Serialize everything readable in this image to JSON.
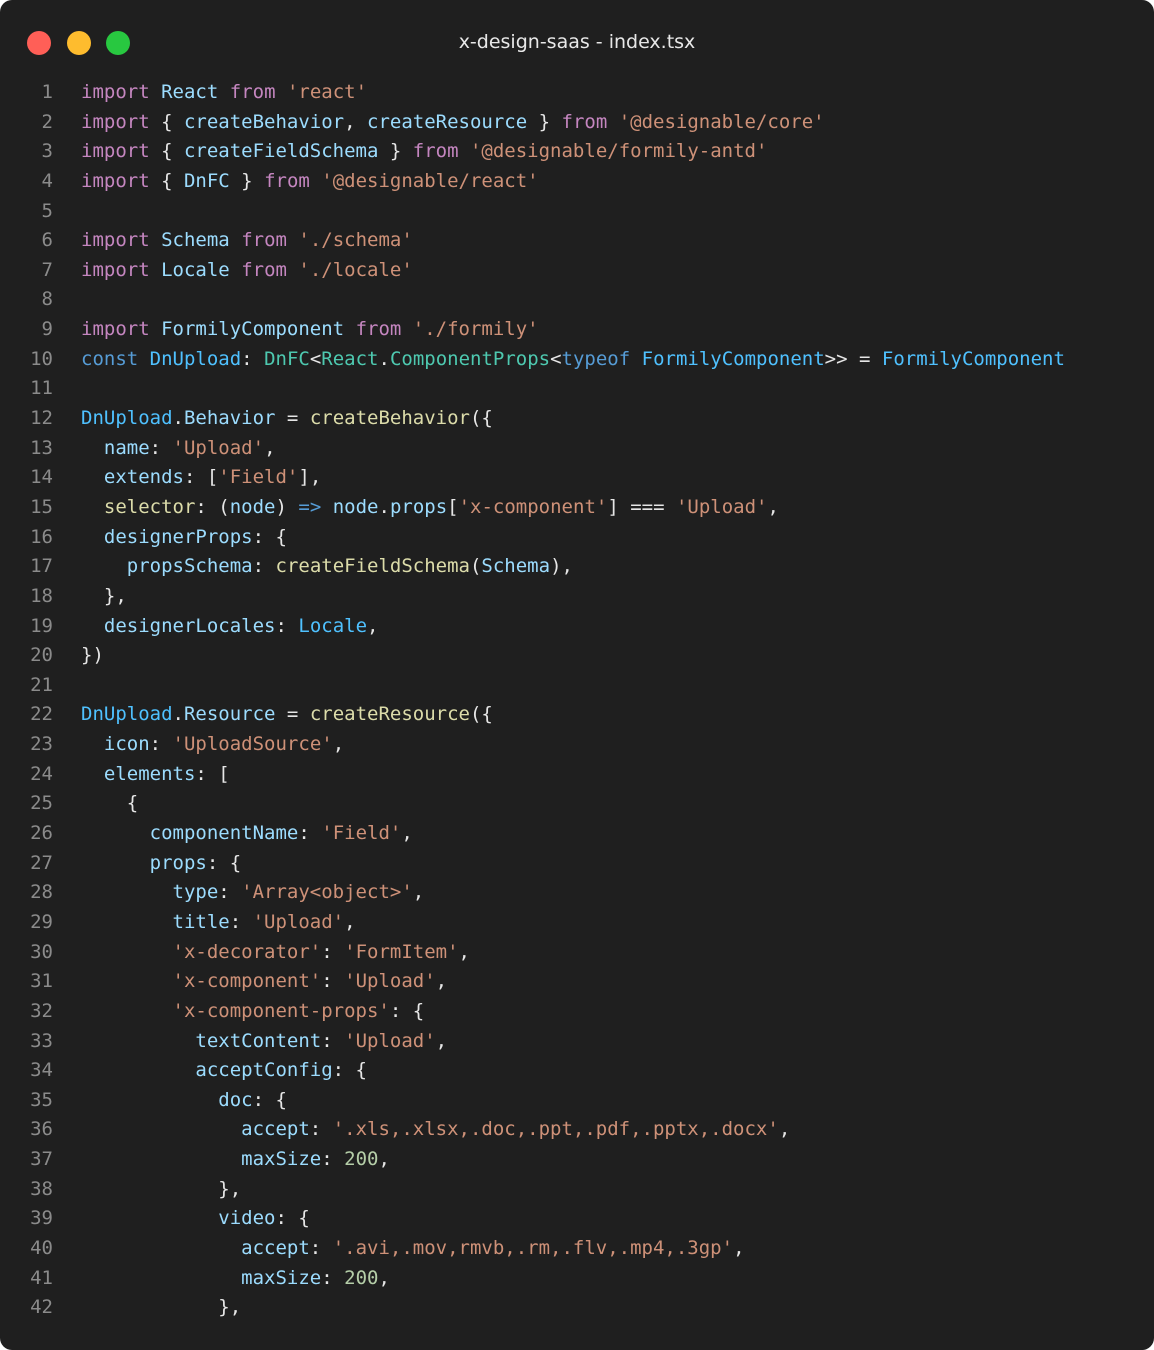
{
  "window": {
    "title": "x-design-saas - index.tsx",
    "controls": [
      "close",
      "minimize",
      "maximize"
    ]
  },
  "colors": {
    "background": "#1f1f1f",
    "keyword": "#c586c0",
    "string": "#ce9178",
    "variable": "#9cdcfe",
    "constant": "#4fc1ff",
    "type": "#4ec9b0",
    "function": "#dcdcaa",
    "number": "#b5cea8",
    "storage": "#569cd6",
    "plain": "#e6e6e6",
    "line_number": "#8b8b8b"
  },
  "editor": {
    "lines": [
      {
        "n": "1",
        "tokens": [
          [
            "kw",
            "import"
          ],
          [
            "pl",
            " "
          ],
          [
            "va",
            "React"
          ],
          [
            "pl",
            " "
          ],
          [
            "kw",
            "from"
          ],
          [
            "pl",
            " "
          ],
          [
            "st",
            "'react'"
          ]
        ]
      },
      {
        "n": "2",
        "tokens": [
          [
            "kw",
            "import"
          ],
          [
            "pl",
            " { "
          ],
          [
            "va",
            "createBehavior"
          ],
          [
            "pl",
            ", "
          ],
          [
            "va",
            "createResource"
          ],
          [
            "pl",
            " } "
          ],
          [
            "kw",
            "from"
          ],
          [
            "pl",
            " "
          ],
          [
            "st",
            "'@designable/core'"
          ]
        ]
      },
      {
        "n": "3",
        "tokens": [
          [
            "kw",
            "import"
          ],
          [
            "pl",
            " { "
          ],
          [
            "va",
            "createFieldSchema"
          ],
          [
            "pl",
            " } "
          ],
          [
            "kw",
            "from"
          ],
          [
            "pl",
            " "
          ],
          [
            "st",
            "'@designable/formily-antd'"
          ]
        ]
      },
      {
        "n": "4",
        "tokens": [
          [
            "kw",
            "import"
          ],
          [
            "pl",
            " { "
          ],
          [
            "va",
            "DnFC"
          ],
          [
            "pl",
            " } "
          ],
          [
            "kw",
            "from"
          ],
          [
            "pl",
            " "
          ],
          [
            "st",
            "'@designable/react'"
          ]
        ]
      },
      {
        "n": "5",
        "tokens": []
      },
      {
        "n": "6",
        "tokens": [
          [
            "kw",
            "import"
          ],
          [
            "pl",
            " "
          ],
          [
            "va",
            "Schema"
          ],
          [
            "pl",
            " "
          ],
          [
            "kw",
            "from"
          ],
          [
            "pl",
            " "
          ],
          [
            "st",
            "'./schema'"
          ]
        ]
      },
      {
        "n": "7",
        "tokens": [
          [
            "kw",
            "import"
          ],
          [
            "pl",
            " "
          ],
          [
            "va",
            "Locale"
          ],
          [
            "pl",
            " "
          ],
          [
            "kw",
            "from"
          ],
          [
            "pl",
            " "
          ],
          [
            "st",
            "'./locale'"
          ]
        ]
      },
      {
        "n": "8",
        "tokens": []
      },
      {
        "n": "9",
        "tokens": [
          [
            "kw",
            "import"
          ],
          [
            "pl",
            " "
          ],
          [
            "va",
            "FormilyComponent"
          ],
          [
            "pl",
            " "
          ],
          [
            "kw",
            "from"
          ],
          [
            "pl",
            " "
          ],
          [
            "st",
            "'./formily'"
          ]
        ]
      },
      {
        "n": "10",
        "tokens": [
          [
            "ke",
            "const"
          ],
          [
            "pl",
            " "
          ],
          [
            "co",
            "DnUpload"
          ],
          [
            "pl",
            ": "
          ],
          [
            "ty",
            "DnFC"
          ],
          [
            "pl",
            "<"
          ],
          [
            "ty",
            "React"
          ],
          [
            "pl",
            "."
          ],
          [
            "ty",
            "ComponentProps"
          ],
          [
            "pl",
            "<"
          ],
          [
            "ke",
            "typeof"
          ],
          [
            "pl",
            " "
          ],
          [
            "co",
            "FormilyComponent"
          ],
          [
            "pl",
            ">> = "
          ],
          [
            "co",
            "FormilyComponent"
          ]
        ]
      },
      {
        "n": "11",
        "tokens": []
      },
      {
        "n": "12",
        "tokens": [
          [
            "co",
            "DnUpload"
          ],
          [
            "pl",
            "."
          ],
          [
            "va",
            "Behavior"
          ],
          [
            "pl",
            " = "
          ],
          [
            "fn",
            "createBehavior"
          ],
          [
            "pl",
            "({"
          ]
        ]
      },
      {
        "n": "13",
        "tokens": [
          [
            "pl",
            "  "
          ],
          [
            "va",
            "name"
          ],
          [
            "pl",
            ": "
          ],
          [
            "st",
            "'Upload'"
          ],
          [
            "pl",
            ","
          ]
        ]
      },
      {
        "n": "14",
        "tokens": [
          [
            "pl",
            "  "
          ],
          [
            "va",
            "extends"
          ],
          [
            "pl",
            ": ["
          ],
          [
            "st",
            "'Field'"
          ],
          [
            "pl",
            "],"
          ]
        ]
      },
      {
        "n": "15",
        "tokens": [
          [
            "pl",
            "  "
          ],
          [
            "fn",
            "selector"
          ],
          [
            "pl",
            ": ("
          ],
          [
            "va",
            "node"
          ],
          [
            "pl",
            ") "
          ],
          [
            "ke",
            "=>"
          ],
          [
            "pl",
            " "
          ],
          [
            "va",
            "node"
          ],
          [
            "pl",
            "."
          ],
          [
            "va",
            "props"
          ],
          [
            "pl",
            "["
          ],
          [
            "st",
            "'x-component'"
          ],
          [
            "pl",
            "] === "
          ],
          [
            "st",
            "'Upload'"
          ],
          [
            "pl",
            ","
          ]
        ]
      },
      {
        "n": "16",
        "tokens": [
          [
            "pl",
            "  "
          ],
          [
            "va",
            "designerProps"
          ],
          [
            "pl",
            ": {"
          ]
        ]
      },
      {
        "n": "17",
        "tokens": [
          [
            "pl",
            "    "
          ],
          [
            "va",
            "propsSchema"
          ],
          [
            "pl",
            ": "
          ],
          [
            "fn",
            "createFieldSchema"
          ],
          [
            "pl",
            "("
          ],
          [
            "va",
            "Schema"
          ],
          [
            "pl",
            "),"
          ]
        ]
      },
      {
        "n": "18",
        "tokens": [
          [
            "pl",
            "  },"
          ]
        ]
      },
      {
        "n": "19",
        "tokens": [
          [
            "pl",
            "  "
          ],
          [
            "va",
            "designerLocales"
          ],
          [
            "pl",
            ": "
          ],
          [
            "co",
            "Locale"
          ],
          [
            "pl",
            ","
          ]
        ]
      },
      {
        "n": "20",
        "tokens": [
          [
            "pl",
            "})"
          ]
        ]
      },
      {
        "n": "21",
        "tokens": []
      },
      {
        "n": "22",
        "tokens": [
          [
            "co",
            "DnUpload"
          ],
          [
            "pl",
            "."
          ],
          [
            "va",
            "Resource"
          ],
          [
            "pl",
            " = "
          ],
          [
            "fn",
            "createResource"
          ],
          [
            "pl",
            "({"
          ]
        ]
      },
      {
        "n": "23",
        "tokens": [
          [
            "pl",
            "  "
          ],
          [
            "va",
            "icon"
          ],
          [
            "pl",
            ": "
          ],
          [
            "st",
            "'UploadSource'"
          ],
          [
            "pl",
            ","
          ]
        ]
      },
      {
        "n": "24",
        "tokens": [
          [
            "pl",
            "  "
          ],
          [
            "va",
            "elements"
          ],
          [
            "pl",
            ": ["
          ]
        ]
      },
      {
        "n": "25",
        "tokens": [
          [
            "pl",
            "    {"
          ]
        ]
      },
      {
        "n": "26",
        "tokens": [
          [
            "pl",
            "      "
          ],
          [
            "va",
            "componentName"
          ],
          [
            "pl",
            ": "
          ],
          [
            "st",
            "'Field'"
          ],
          [
            "pl",
            ","
          ]
        ]
      },
      {
        "n": "27",
        "tokens": [
          [
            "pl",
            "      "
          ],
          [
            "va",
            "props"
          ],
          [
            "pl",
            ": {"
          ]
        ]
      },
      {
        "n": "28",
        "tokens": [
          [
            "pl",
            "        "
          ],
          [
            "va",
            "type"
          ],
          [
            "pl",
            ": "
          ],
          [
            "st",
            "'Array<object>'"
          ],
          [
            "pl",
            ","
          ]
        ]
      },
      {
        "n": "29",
        "tokens": [
          [
            "pl",
            "        "
          ],
          [
            "va",
            "title"
          ],
          [
            "pl",
            ": "
          ],
          [
            "st",
            "'Upload'"
          ],
          [
            "pl",
            ","
          ]
        ]
      },
      {
        "n": "30",
        "tokens": [
          [
            "pl",
            "        "
          ],
          [
            "st",
            "'x-decorator'"
          ],
          [
            "pl",
            ": "
          ],
          [
            "st",
            "'FormItem'"
          ],
          [
            "pl",
            ","
          ]
        ]
      },
      {
        "n": "31",
        "tokens": [
          [
            "pl",
            "        "
          ],
          [
            "st",
            "'x-component'"
          ],
          [
            "pl",
            ": "
          ],
          [
            "st",
            "'Upload'"
          ],
          [
            "pl",
            ","
          ]
        ]
      },
      {
        "n": "32",
        "tokens": [
          [
            "pl",
            "        "
          ],
          [
            "st",
            "'x-component-props'"
          ],
          [
            "pl",
            ": {"
          ]
        ]
      },
      {
        "n": "33",
        "tokens": [
          [
            "pl",
            "          "
          ],
          [
            "va",
            "textContent"
          ],
          [
            "pl",
            ": "
          ],
          [
            "st",
            "'Upload'"
          ],
          [
            "pl",
            ","
          ]
        ]
      },
      {
        "n": "34",
        "tokens": [
          [
            "pl",
            "          "
          ],
          [
            "va",
            "acceptConfig"
          ],
          [
            "pl",
            ": {"
          ]
        ]
      },
      {
        "n": "35",
        "tokens": [
          [
            "pl",
            "            "
          ],
          [
            "va",
            "doc"
          ],
          [
            "pl",
            ": {"
          ]
        ]
      },
      {
        "n": "36",
        "tokens": [
          [
            "pl",
            "              "
          ],
          [
            "va",
            "accept"
          ],
          [
            "pl",
            ": "
          ],
          [
            "st",
            "'.xls,.xlsx,.doc,.ppt,.pdf,.pptx,.docx'"
          ],
          [
            "pl",
            ","
          ]
        ]
      },
      {
        "n": "37",
        "tokens": [
          [
            "pl",
            "              "
          ],
          [
            "va",
            "maxSize"
          ],
          [
            "pl",
            ": "
          ],
          [
            "nu",
            "200"
          ],
          [
            "pl",
            ","
          ]
        ]
      },
      {
        "n": "38",
        "tokens": [
          [
            "pl",
            "            },"
          ]
        ]
      },
      {
        "n": "39",
        "tokens": [
          [
            "pl",
            "            "
          ],
          [
            "va",
            "video"
          ],
          [
            "pl",
            ": {"
          ]
        ]
      },
      {
        "n": "40",
        "tokens": [
          [
            "pl",
            "              "
          ],
          [
            "va",
            "accept"
          ],
          [
            "pl",
            ": "
          ],
          [
            "st",
            "'.avi,.mov,rmvb,.rm,.flv,.mp4,.3gp'"
          ],
          [
            "pl",
            ","
          ]
        ]
      },
      {
        "n": "41",
        "tokens": [
          [
            "pl",
            "              "
          ],
          [
            "va",
            "maxSize"
          ],
          [
            "pl",
            ": "
          ],
          [
            "nu",
            "200"
          ],
          [
            "pl",
            ","
          ]
        ]
      },
      {
        "n": "42",
        "tokens": [
          [
            "pl",
            "            },"
          ]
        ]
      }
    ]
  }
}
